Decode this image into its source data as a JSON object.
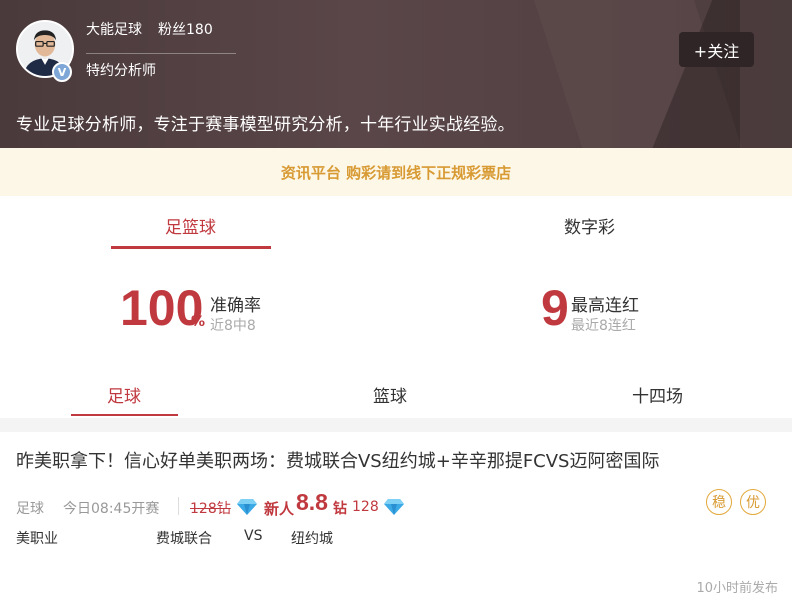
{
  "header": {
    "username": "大能足球",
    "fans": "粉丝180",
    "role": "特约分析师",
    "follow_label": "+关注",
    "verified_badge": "V",
    "bio": "专业足球分析师，专注于赛事模型研究分析，十年行业实战经验。"
  },
  "notice": "资讯平台 购彩请到线下正规彩票店",
  "main_tabs": [
    {
      "label": "足篮球",
      "active": true
    },
    {
      "label": "数字彩",
      "active": false
    }
  ],
  "stats": {
    "accuracy": {
      "value": "100",
      "unit": "%",
      "label": "准确率",
      "sub": "近8中8"
    },
    "streak": {
      "value": "9",
      "label": "最高连红",
      "sub": "最近8连红"
    }
  },
  "sub_tabs": [
    {
      "label": "足球",
      "active": true
    },
    {
      "label": "篮球",
      "active": false
    },
    {
      "label": "十四场",
      "active": false
    }
  ],
  "article": {
    "title": "昨美职拿下！信心好单美职两场：费城联合VS纽约城+辛辛那提FCVS迈阿密国际",
    "category": "足球",
    "time": "今日08:45开赛",
    "old_price": "128钻",
    "new_label": "新人",
    "new_price": "8.8",
    "new_unit": "钻",
    "price_count": "128",
    "badges": [
      "稳",
      "优"
    ],
    "league": "美职业",
    "home_team": "费城联合",
    "vs": "VS",
    "away_team": "纽约城",
    "published": "10小时前发布"
  },
  "colors": {
    "accent": "#c0393f",
    "gold": "#d89a33",
    "header_bg": "#4a3a3c",
    "diamond": "#3ba9e6"
  }
}
